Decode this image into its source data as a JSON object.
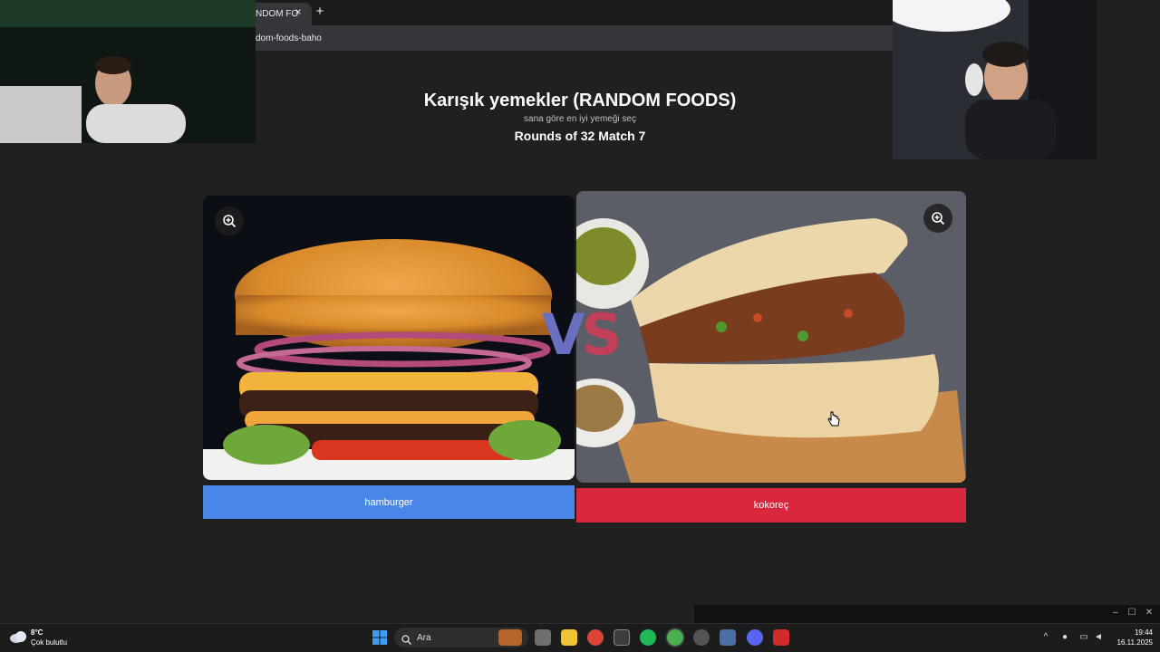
{
  "browser": {
    "tab_label": "NDOM FO",
    "tab_close": "×",
    "new_tab": "+",
    "url": "dom-foods-baho"
  },
  "page": {
    "title": "Karışık yemekler (RANDOM FOODS)",
    "subtitle": "sana göre en iyi yemeği seç",
    "round_label": "Rounds of 32 Match 7",
    "vs_v": "V",
    "vs_s": "S"
  },
  "left_choice": {
    "label": "hamburger",
    "button_color": "#4a86e8",
    "image_icon": "hamburger-photo",
    "zoom_icon": "zoom-in-icon"
  },
  "right_choice": {
    "label": "kokoreç",
    "button_color": "#d9273d",
    "image_icon": "kokorec-sandwich-photo",
    "zoom_icon": "zoom-in-icon"
  },
  "taskbar": {
    "weather_temp": "8°C",
    "weather_condition": "Çok bulutlu",
    "search_placeholder": "Ara",
    "time": "19:44",
    "date": "16.11.2025"
  },
  "window_controls": {
    "minimize": "–",
    "maximize": "☐",
    "close": "✕"
  }
}
